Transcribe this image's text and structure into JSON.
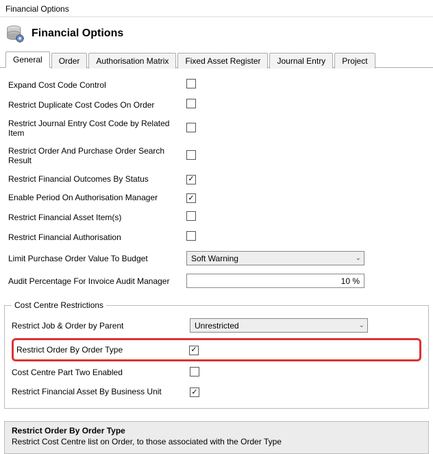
{
  "windowTitle": "Financial Options",
  "header": {
    "title": "Financial Options"
  },
  "tabs": {
    "items": [
      {
        "label": "General",
        "active": true
      },
      {
        "label": "Order",
        "active": false
      },
      {
        "label": "Authorisation Matrix",
        "active": false
      },
      {
        "label": "Fixed Asset Register",
        "active": false
      },
      {
        "label": "Journal Entry",
        "active": false
      },
      {
        "label": "Project",
        "active": false
      }
    ]
  },
  "generalOptions": [
    {
      "label": "Expand Cost Code Control",
      "checked": false
    },
    {
      "label": "Restrict Duplicate Cost Codes On Order",
      "checked": false
    },
    {
      "label": "Restrict Journal Entry Cost Code by Related Item",
      "checked": false
    },
    {
      "label": "Restrict Order And Purchase Order Search Result",
      "checked": false
    },
    {
      "label": "Restrict Financial Outcomes By Status",
      "checked": true
    },
    {
      "label": "Enable Period On Authorisation Manager",
      "checked": true
    },
    {
      "label": "Restrict Financial Asset Item(s)",
      "checked": false
    },
    {
      "label": "Restrict Financial Authorisation",
      "checked": false
    }
  ],
  "limitPO": {
    "label": "Limit Purchase Order Value To Budget",
    "value": "Soft Warning"
  },
  "auditPct": {
    "label": "Audit Percentage For Invoice Audit Manager",
    "value": "10 %"
  },
  "ccr": {
    "legend": "Cost Centre Restrictions",
    "restrictJobOrder": {
      "label": "Restrict Job & Order by Parent",
      "value": "Unrestricted"
    },
    "restrictOrderType": {
      "label": "Restrict Order By Order Type",
      "checked": true
    },
    "ccPartTwo": {
      "label": "Cost Centre Part Two Enabled",
      "checked": false
    },
    "restrictAssetBU": {
      "label": "Restrict Financial Asset By Business Unit",
      "checked": true
    }
  },
  "help": {
    "title": "Restrict Order By Order Type",
    "desc": "Restrict Cost Centre list on Order, to those associated with the Order Type"
  }
}
